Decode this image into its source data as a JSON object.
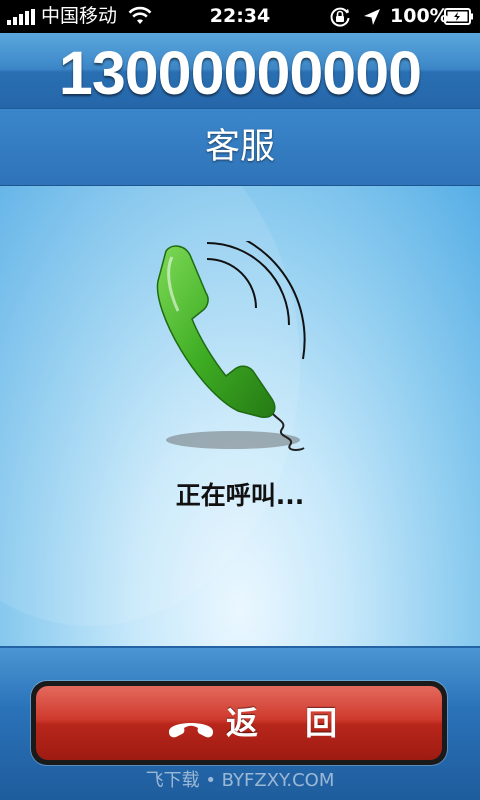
{
  "status_bar": {
    "carrier": "中国移动",
    "time": "22:34",
    "battery": "100%",
    "icons": [
      "signal-icon",
      "wifi-icon",
      "rotation-lock-icon",
      "location-icon",
      "battery-icon"
    ]
  },
  "call": {
    "number": "13000000000",
    "contact": "客服",
    "status": "正在呼叫...",
    "illustration": "green-phone-handset-icon"
  },
  "actions": {
    "back_label": "返 回",
    "back_icon": "hang-up-icon"
  },
  "watermark": "飞下载 • BYFZXY.COM",
  "colors": {
    "header_blue": "#2e73b8",
    "handset_green": "#3fae24",
    "button_red": "#cf3a2d"
  }
}
